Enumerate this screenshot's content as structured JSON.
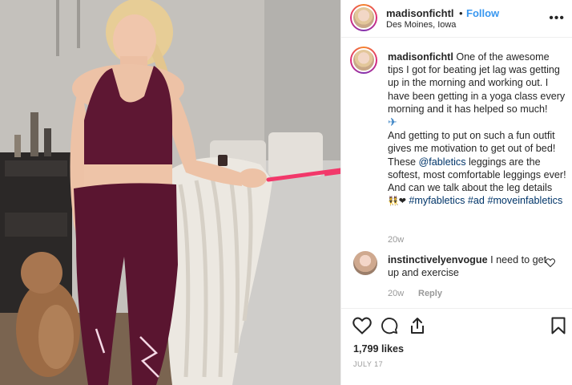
{
  "post": {
    "username": "madisonfichtl",
    "separator": "•",
    "follow_label": "Follow",
    "location": "Des Moines, Iowa",
    "more_icon": "more-options-icon"
  },
  "caption": {
    "username": "madisonfichtl",
    "p1": "One of the awesome tips I got for beating jet lag was getting up in the morning and working out. I have been getting in a yoga class every morning and it has helped so much!",
    "plane": "✈",
    "p2a": "And getting to put on such a fun outfit gives me motivation to get out of bed! These ",
    "mention": "@fabletics",
    "p2b": " leggings are the softest, most comfortable leggings ever! And can we talk about the leg details ",
    "emojis": "👯❤",
    "tag1": "#myfabletics",
    "tag2": "#ad",
    "tag3": "#moveinfabletics",
    "time": "20w"
  },
  "comment": {
    "username": "instinctivelyenvogue",
    "text": " I need to get up and exercise",
    "time": "20w",
    "reply_label": "Reply"
  },
  "actions": {
    "like_icon": "heart-icon",
    "comment_icon": "comment-icon",
    "share_icon": "share-icon",
    "save_icon": "bookmark-icon"
  },
  "likes": "1,799 likes",
  "date": "JULY 17",
  "colors": {
    "follow_blue": "#3897f0",
    "link_navy": "#003569",
    "arrow_pink": "#f2386a",
    "outfit_burgundy": "#5e1733"
  }
}
